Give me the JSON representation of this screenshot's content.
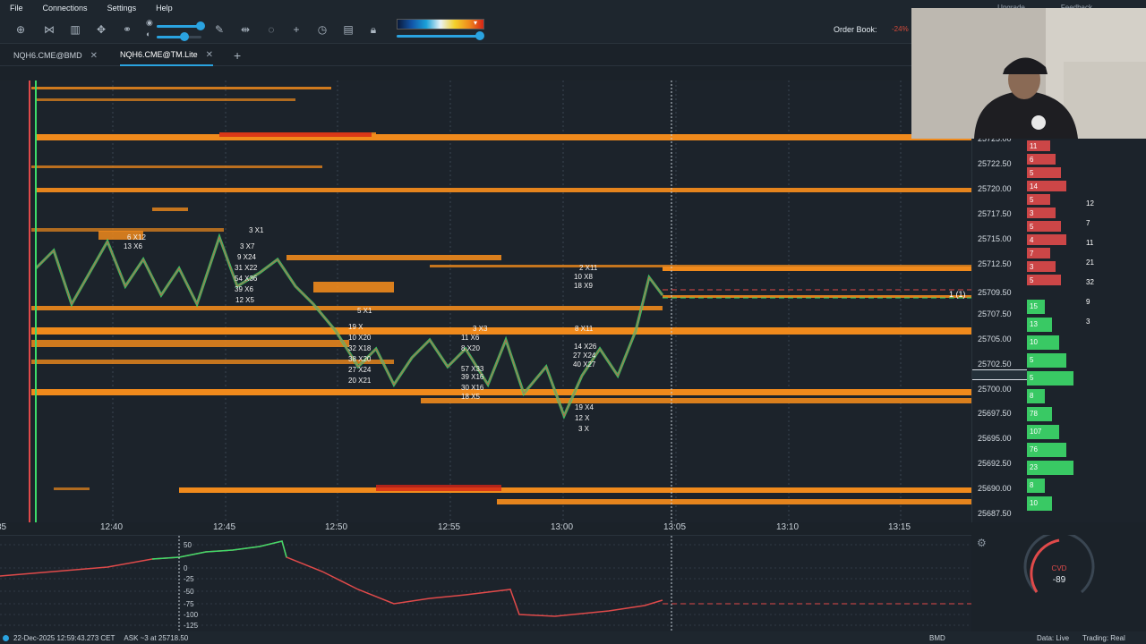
{
  "menu": {
    "items": [
      "File",
      "Connections",
      "Settings",
      "Help"
    ],
    "right_items": [
      "Upgrade",
      "Feedback"
    ]
  },
  "toolbar": {
    "icons": [
      "zoom-fit-icon",
      "share-icon",
      "chart-icon",
      "drawing-icon",
      "link-icon",
      "pen-icon",
      "measure-icon",
      "comment-icon",
      "crosshair-icon",
      "timer-icon",
      "layout-icon",
      "lock-icon"
    ],
    "order_book_label": "Order Book:",
    "order_book_value": "-24%"
  },
  "tabs": [
    {
      "label": "NQH6.CME@BMD",
      "active": false
    },
    {
      "label": "NQH6.CME@TM.Lite",
      "active": true
    }
  ],
  "price_axis": [
    "25725.00",
    "25722.50",
    "25720.00",
    "25717.50",
    "25715.00",
    "25712.50",
    "25709.50",
    "25707.50",
    "25705.00",
    "25702.50",
    "25700.00",
    "25697.50",
    "25695.00",
    "25692.50",
    "25690.00",
    "25687.50"
  ],
  "current_price_tag": "1 (1)",
  "time_axis": [
    "35",
    "12:40",
    "12:45",
    "12:50",
    "12:55",
    "13:00",
    "13:05",
    "13:10",
    "13:15"
  ],
  "cvd": {
    "label": "CVD",
    "value": "-89",
    "axis": [
      "50",
      "0",
      "-25",
      "-50",
      "-75",
      "-100",
      "-125"
    ]
  },
  "dom_ask_sizes": [
    "11",
    "6",
    "5",
    "14",
    "5",
    "3",
    "5",
    "4",
    "7",
    "3",
    "5"
  ],
  "dom_bid_sizes": [
    "15",
    "13",
    "10",
    "5",
    "5",
    "8",
    "78",
    "107",
    "76",
    "23",
    "8",
    "10",
    "12",
    "7",
    "11",
    "21",
    "32",
    "9",
    "3"
  ],
  "overlay_labels": [
    "3 X1",
    "6 X12",
    "13 X6",
    "3 X7",
    "9 X24",
    "31 X22",
    "54 X36",
    "39 X6",
    "12 X5",
    "2 X11",
    "10 X8",
    "18 X9",
    "8 X11",
    "14 X26",
    "27 X24",
    "40 X27",
    "19 X4",
    "12 X",
    "3 X",
    "5 X1",
    "19 X",
    "10 X20",
    "32 X18",
    "38 X20",
    "27 X24",
    "20 X21",
    "3 X3",
    "11 X6",
    "8 X20",
    "57 X33",
    "39 X16",
    "30 X16",
    "18 X5"
  ],
  "status": {
    "timestamp": "22-Dec-2025 12:59:43.273 CET",
    "ask": "ASK ~3 at 25718.50",
    "exchange": "BMD",
    "data": "Data: Live",
    "trading": "Trading: Real"
  },
  "colors": {
    "heat_orange": "#f08a1c",
    "heat_red": "#d62416",
    "up_green": "#3ddc6a",
    "down_red": "#e04a4a",
    "accent": "#2aa3e0"
  }
}
